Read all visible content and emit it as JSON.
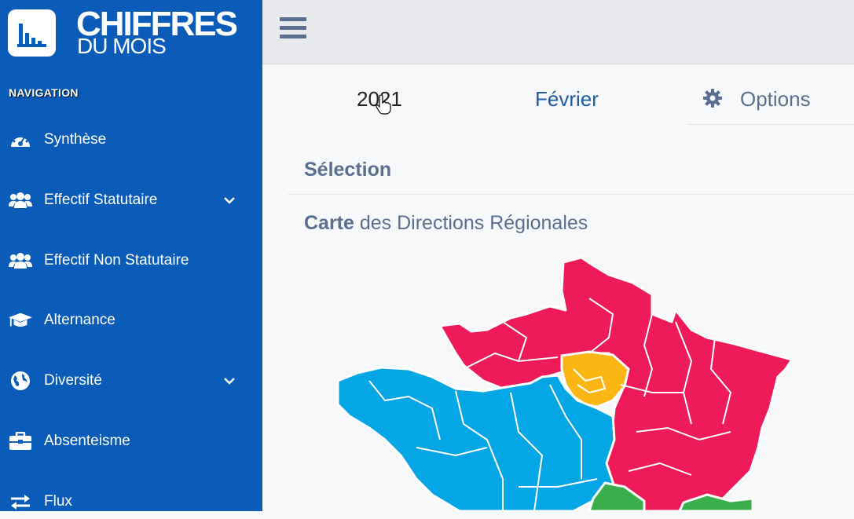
{
  "brand": {
    "line1": "CHIFFRES",
    "line2": "DU MOIS"
  },
  "navigation": {
    "title": "NAVIGATION",
    "items": [
      {
        "label": "Synthèse",
        "icon": "dashboard-icon",
        "expandable": false
      },
      {
        "label": "Effectif Statutaire",
        "icon": "users-icon",
        "expandable": true
      },
      {
        "label": "Effectif Non Statutaire",
        "icon": "users-icon",
        "expandable": false
      },
      {
        "label": "Alternance",
        "icon": "graduation-cap-icon",
        "expandable": false
      },
      {
        "label": "Diversité",
        "icon": "globe-icon",
        "expandable": true
      },
      {
        "label": "Absenteisme",
        "icon": "briefcase-icon",
        "expandable": false
      },
      {
        "label": "Flux",
        "icon": "exchange-icon",
        "expandable": false
      }
    ]
  },
  "filters": {
    "year": "2021",
    "month": "Février",
    "options_label": "Options"
  },
  "selection": {
    "title": "Sélection"
  },
  "map": {
    "title_bold": "Carte",
    "title_rest": " des Directions Régionales"
  },
  "colors": {
    "sidebar": "#0b5cb8",
    "region_red": "#ee1a5a",
    "region_blue": "#05a6e6",
    "region_yellow": "#fbb614",
    "region_green": "#3aae4a"
  }
}
